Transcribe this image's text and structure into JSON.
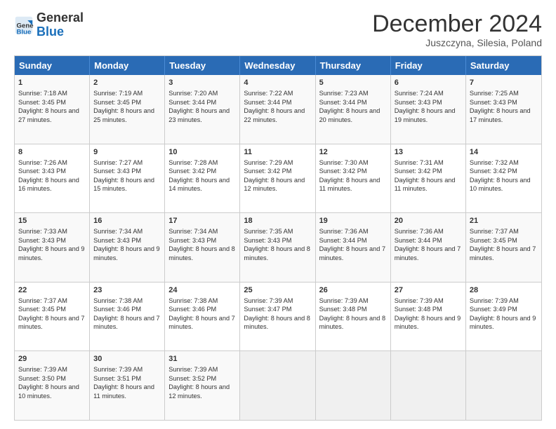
{
  "header": {
    "logo_line1": "General",
    "logo_line2": "Blue",
    "main_title": "December 2024",
    "subtitle": "Juszczyna, Silesia, Poland"
  },
  "calendar": {
    "days_of_week": [
      "Sunday",
      "Monday",
      "Tuesday",
      "Wednesday",
      "Thursday",
      "Friday",
      "Saturday"
    ],
    "weeks": [
      [
        {
          "day": 1,
          "sunrise": "7:18 AM",
          "sunset": "3:45 PM",
          "daylight": "8 hours and 27 minutes."
        },
        {
          "day": 2,
          "sunrise": "7:19 AM",
          "sunset": "3:45 PM",
          "daylight": "8 hours and 25 minutes."
        },
        {
          "day": 3,
          "sunrise": "7:20 AM",
          "sunset": "3:44 PM",
          "daylight": "8 hours and 23 minutes."
        },
        {
          "day": 4,
          "sunrise": "7:22 AM",
          "sunset": "3:44 PM",
          "daylight": "8 hours and 22 minutes."
        },
        {
          "day": 5,
          "sunrise": "7:23 AM",
          "sunset": "3:44 PM",
          "daylight": "8 hours and 20 minutes."
        },
        {
          "day": 6,
          "sunrise": "7:24 AM",
          "sunset": "3:43 PM",
          "daylight": "8 hours and 19 minutes."
        },
        {
          "day": 7,
          "sunrise": "7:25 AM",
          "sunset": "3:43 PM",
          "daylight": "8 hours and 17 minutes."
        }
      ],
      [
        {
          "day": 8,
          "sunrise": "7:26 AM",
          "sunset": "3:43 PM",
          "daylight": "8 hours and 16 minutes."
        },
        {
          "day": 9,
          "sunrise": "7:27 AM",
          "sunset": "3:43 PM",
          "daylight": "8 hours and 15 minutes."
        },
        {
          "day": 10,
          "sunrise": "7:28 AM",
          "sunset": "3:42 PM",
          "daylight": "8 hours and 14 minutes."
        },
        {
          "day": 11,
          "sunrise": "7:29 AM",
          "sunset": "3:42 PM",
          "daylight": "8 hours and 12 minutes."
        },
        {
          "day": 12,
          "sunrise": "7:30 AM",
          "sunset": "3:42 PM",
          "daylight": "8 hours and 11 minutes."
        },
        {
          "day": 13,
          "sunrise": "7:31 AM",
          "sunset": "3:42 PM",
          "daylight": "8 hours and 11 minutes."
        },
        {
          "day": 14,
          "sunrise": "7:32 AM",
          "sunset": "3:42 PM",
          "daylight": "8 hours and 10 minutes."
        }
      ],
      [
        {
          "day": 15,
          "sunrise": "7:33 AM",
          "sunset": "3:43 PM",
          "daylight": "8 hours and 9 minutes."
        },
        {
          "day": 16,
          "sunrise": "7:34 AM",
          "sunset": "3:43 PM",
          "daylight": "8 hours and 9 minutes."
        },
        {
          "day": 17,
          "sunrise": "7:34 AM",
          "sunset": "3:43 PM",
          "daylight": "8 hours and 8 minutes."
        },
        {
          "day": 18,
          "sunrise": "7:35 AM",
          "sunset": "3:43 PM",
          "daylight": "8 hours and 8 minutes."
        },
        {
          "day": 19,
          "sunrise": "7:36 AM",
          "sunset": "3:44 PM",
          "daylight": "8 hours and 7 minutes."
        },
        {
          "day": 20,
          "sunrise": "7:36 AM",
          "sunset": "3:44 PM",
          "daylight": "8 hours and 7 minutes."
        },
        {
          "day": 21,
          "sunrise": "7:37 AM",
          "sunset": "3:45 PM",
          "daylight": "8 hours and 7 minutes."
        }
      ],
      [
        {
          "day": 22,
          "sunrise": "7:37 AM",
          "sunset": "3:45 PM",
          "daylight": "8 hours and 7 minutes."
        },
        {
          "day": 23,
          "sunrise": "7:38 AM",
          "sunset": "3:46 PM",
          "daylight": "8 hours and 7 minutes."
        },
        {
          "day": 24,
          "sunrise": "7:38 AM",
          "sunset": "3:46 PM",
          "daylight": "8 hours and 7 minutes."
        },
        {
          "day": 25,
          "sunrise": "7:39 AM",
          "sunset": "3:47 PM",
          "daylight": "8 hours and 8 minutes."
        },
        {
          "day": 26,
          "sunrise": "7:39 AM",
          "sunset": "3:48 PM",
          "daylight": "8 hours and 8 minutes."
        },
        {
          "day": 27,
          "sunrise": "7:39 AM",
          "sunset": "3:48 PM",
          "daylight": "8 hours and 9 minutes."
        },
        {
          "day": 28,
          "sunrise": "7:39 AM",
          "sunset": "3:49 PM",
          "daylight": "8 hours and 9 minutes."
        }
      ],
      [
        {
          "day": 29,
          "sunrise": "7:39 AM",
          "sunset": "3:50 PM",
          "daylight": "8 hours and 10 minutes."
        },
        {
          "day": 30,
          "sunrise": "7:39 AM",
          "sunset": "3:51 PM",
          "daylight": "8 hours and 11 minutes."
        },
        {
          "day": 31,
          "sunrise": "7:39 AM",
          "sunset": "3:52 PM",
          "daylight": "8 hours and 12 minutes."
        },
        null,
        null,
        null,
        null
      ]
    ]
  }
}
